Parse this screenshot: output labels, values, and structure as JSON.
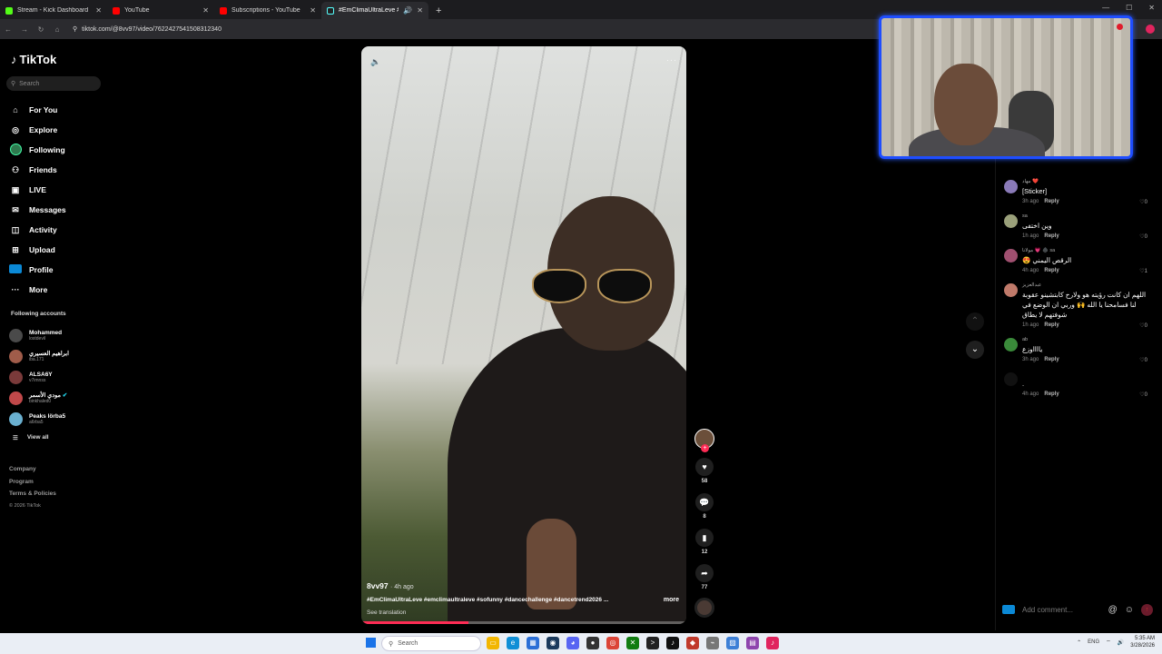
{
  "browser": {
    "tabs": [
      {
        "title": "Stream - Kick Dashboard",
        "color": "#53fc18",
        "active": false
      },
      {
        "title": "YouTube",
        "color": "#ff0000",
        "active": false
      },
      {
        "title": "Subscriptions - YouTube",
        "color": "#ff0000",
        "active": false
      },
      {
        "title": "#EmClimaUltraLeve #emcli",
        "color": "#222222",
        "active": true
      }
    ],
    "url": "tiktok.com/@8vv97/video/7622427541508312340"
  },
  "sidebar": {
    "logo": "TikTok",
    "search_placeholder": "Search",
    "nav": [
      {
        "label": "For You",
        "icon": "home-icon"
      },
      {
        "label": "Explore",
        "icon": "compass-icon"
      },
      {
        "label": "Following",
        "icon": "following-avatar-icon"
      },
      {
        "label": "Friends",
        "icon": "friends-icon"
      },
      {
        "label": "LIVE",
        "icon": "live-icon"
      },
      {
        "label": "Messages",
        "icon": "messages-icon"
      },
      {
        "label": "Activity",
        "icon": "activity-icon"
      },
      {
        "label": "Upload",
        "icon": "upload-icon"
      },
      {
        "label": "Profile",
        "icon": "profile-icon"
      },
      {
        "label": "More",
        "icon": "more-icon"
      }
    ],
    "following_title": "Following accounts",
    "accounts": [
      {
        "name": "Mohammed",
        "handle": "lostdevil",
        "color": "#4a4a4a"
      },
      {
        "name": "ابراهيم العسيري",
        "handle": "iba.171",
        "color": "#a05c4a"
      },
      {
        "name": "ALSA6Y",
        "handle": "v7imnss",
        "color": "#7a3a3a"
      },
      {
        "name": "مودي الأسمر",
        "handle": "binkhaled0",
        "color": "#c0484a"
      },
      {
        "name": "Peaks lörba5",
        "handle": "a6rba5",
        "color": "#6ab0d0"
      }
    ],
    "view_all": "View all",
    "footer": [
      "Company",
      "Program",
      "Terms & Policies"
    ],
    "copyright": "© 2026 TikTok"
  },
  "video": {
    "author": "8vv97",
    "ago": "· 4h ago",
    "caption": "#EmClimaUltraLeve #emclimaultraleve #sofunny #dancechallenge #dancetrend2026 ...",
    "more": "more",
    "see_translation": "See translation",
    "progress": 0.33
  },
  "actions": {
    "likes": "58",
    "comments": "8",
    "saves": "12",
    "shares": "77"
  },
  "comments": [
    {
      "user": "مهاد ❤️",
      "text": "[Sticker]",
      "time": "3h ago",
      "reply": "Reply",
      "likes": "0",
      "color": "#8a7ab8"
    },
    {
      "user": "sa",
      "text": "وين اختفى",
      "time": "1h ago",
      "reply": "Reply",
      "likes": "0",
      "color": "#9aa07a"
    },
    {
      "user": "مولانا 💗 ♠️ sa",
      "text": "الرقص اليمني 😍",
      "time": "4h ago",
      "reply": "Reply",
      "likes": "1",
      "color": "#a05070"
    },
    {
      "user": "عبدالعزيز",
      "text": "اللهم ان كانت رؤيته هو ولارح كابتشينو عقوبة لنا فسامحنا يا الله 🙌 وربي ان الوضع في شوفتهم لا يطاق",
      "time": "1h ago",
      "reply": "Reply",
      "likes": "0",
      "color": "#c07a6a"
    },
    {
      "user": "ab",
      "text": "يااااوزع",
      "time": "3h ago",
      "reply": "Reply",
      "likes": "0",
      "color": "#3a8a3a"
    },
    {
      "user": "",
      "text": ".",
      "time": "4h ago",
      "reply": "Reply",
      "likes": "0",
      "color": "#111111"
    }
  ],
  "comment_input": {
    "placeholder": "Add comment..."
  },
  "taskbar": {
    "search": "Search",
    "lang": "ENG",
    "time": "5:35 AM",
    "date": "3/28/2026"
  }
}
